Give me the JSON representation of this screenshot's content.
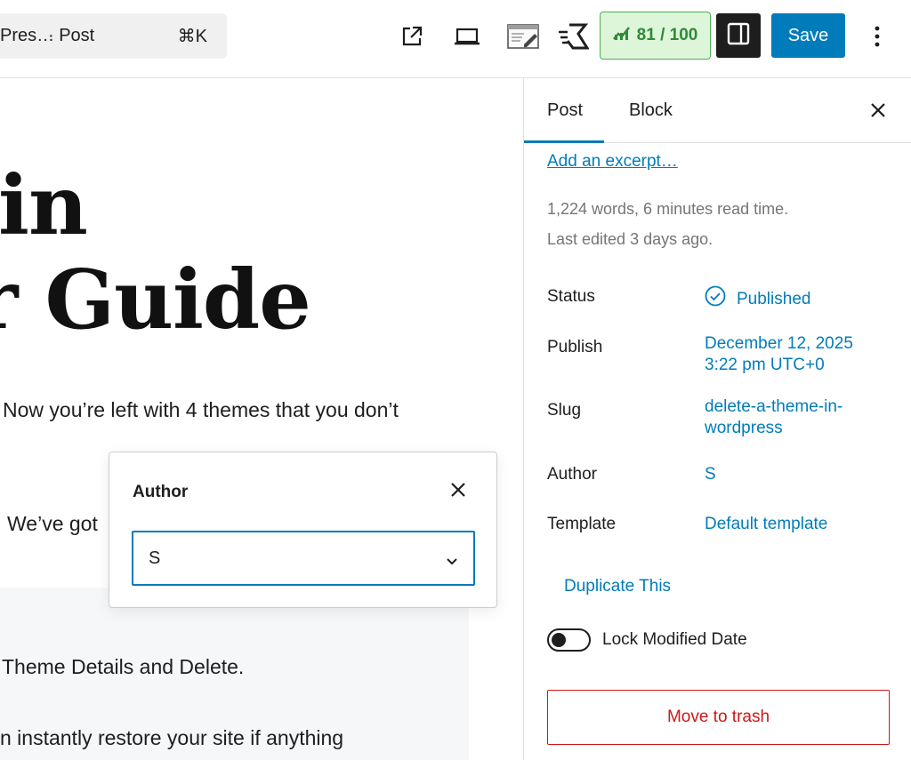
{
  "toolbar": {
    "command_title": "Pres…",
    "command_type": "· Post",
    "command_shortcut": "⌘K",
    "seo_score": "81 / 100",
    "save_label": "Save",
    "icons": [
      "external-link-icon",
      "desktop-preview-icon",
      "edit-page-icon",
      "speed-icon",
      "score-chart-icon",
      "sidebar-toggle-icon",
      "more-options-icon"
    ]
  },
  "editor": {
    "heading_line1": "in",
    "heading_line2": "r Guide",
    "paragraph1": "Now you’re left with 4 themes that you don’t",
    "paragraph2": "We’ve got",
    "paragraph3": "Theme Details and Delete.",
    "paragraph4": "n instantly restore your site if anything"
  },
  "author_popover": {
    "title": "Author",
    "selected_value": "S"
  },
  "sidebar": {
    "tabs": [
      {
        "label": "Post",
        "active": true
      },
      {
        "label": "Block",
        "active": false
      }
    ],
    "excerpt_link": "Add an excerpt…",
    "word_count": "1,224 words, 6 minutes read time.",
    "last_edited": "Last edited 3 days ago.",
    "rows": {
      "status": {
        "label": "Status",
        "value": "Published"
      },
      "publish": {
        "label": "Publish",
        "value_line1": "December 12, 2025",
        "value_line2": "3:22 pm UTC+0"
      },
      "slug": {
        "label": "Slug",
        "value_line1": "delete-a-theme-in-",
        "value_line2": "wordpress"
      },
      "author": {
        "label": "Author",
        "value": "S"
      },
      "template": {
        "label": "Template",
        "value": "Default template"
      }
    },
    "duplicate_link": "Duplicate This",
    "lock_modified_label": "Lock Modified Date",
    "lock_modified_enabled": false,
    "trash_label": "Move to trash"
  },
  "colors": {
    "accent": "#007cba",
    "danger": "#cc1818",
    "seo_bg": "#ddf5d9",
    "seo_text": "#2f8a37"
  }
}
